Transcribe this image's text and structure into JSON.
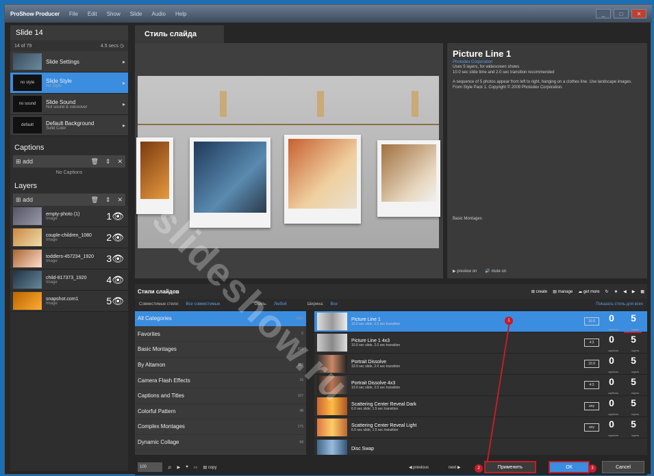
{
  "window": {
    "title": "ProShow Producer",
    "menu": [
      "File",
      "Edit",
      "Show",
      "Slide",
      "Audio",
      "Help"
    ]
  },
  "slide": {
    "title": "Slide 14",
    "index": "14 of 79",
    "time": "4.5 secs"
  },
  "slide_rows": [
    {
      "label": "Slide Settings",
      "sub": ""
    },
    {
      "label": "Slide Style",
      "sub": "No Style",
      "thumb": "no style"
    },
    {
      "label": "Slide Sound",
      "sub": "Not sound & voiceover",
      "thumb": "no sound"
    },
    {
      "label": "Default Background",
      "sub": "Solid Color",
      "thumb": "default"
    }
  ],
  "captions": {
    "title": "Captions",
    "add": "add",
    "empty": "No Captions"
  },
  "layers": {
    "title": "Layers",
    "add": "add",
    "items": [
      {
        "name": "empty-photo (1)",
        "type": "Image",
        "num": "1"
      },
      {
        "name": "couple-children_1080",
        "type": "Image",
        "num": "2"
      },
      {
        "name": "toddlers-457234_1920",
        "type": "Image",
        "num": "3"
      },
      {
        "name": "child-817373_1920",
        "type": "Image",
        "num": "4"
      },
      {
        "name": "snapshot.com1",
        "type": "Image",
        "num": "5"
      }
    ]
  },
  "tab": {
    "label": "Стиль слайда"
  },
  "style_info": {
    "title": "Picture Line 1",
    "link": "Photodex Corporation",
    "desc1": "Uses 5 layers, for widescreen shows",
    "desc2": "10.0 sec slide time and 2.0 sec transition recommended",
    "desc3": "A sequence of 5 photos appear from left to right, hanging on a clothes line. Use landscape images. From Style Pack 1. Copyright © 2009 Photodex Corporation.",
    "basic": "Basic Montages",
    "preview_btn": "preview on",
    "mute_btn": "mute on"
  },
  "watermark": "slideshow.ru",
  "styles_panel": {
    "title": "Стили слайдов",
    "tools": [
      "create",
      "manage",
      "get more"
    ],
    "filters": {
      "compat_label": "Совместимые стили:",
      "compat_val": "Все совместимые",
      "aspect_label": "Стиль:",
      "aspect_val": "Любой",
      "count_label": "Ширина:",
      "count_val": "Все",
      "recommend": "Показать стиль для всех"
    }
  },
  "categories": [
    {
      "name": "All Categories",
      "count": "1063",
      "sel": true
    },
    {
      "name": "Favorites",
      "count": "0"
    },
    {
      "name": "Basic Montages",
      "count": "216"
    },
    {
      "name": "By Altamon",
      "count": "368"
    },
    {
      "name": "Camera Flash Effects",
      "count": "16"
    },
    {
      "name": "Captions and Titles",
      "count": "107"
    },
    {
      "name": "Colorful Pattern",
      "count": "48"
    },
    {
      "name": "Complex Montages",
      "count": "175"
    },
    {
      "name": "Dynamic Collage",
      "count": "68"
    }
  ],
  "styles": [
    {
      "name": "Picture Line 1",
      "desc": "10.0 sec slide, 2.0 sec transition",
      "aspect": "16:9",
      "captions": "0",
      "layers": "5",
      "sel": true
    },
    {
      "name": "Picture Line 1 4x3",
      "desc": "10.0 sec slide, 2.0 sec transition",
      "aspect": "4:3",
      "captions": "0",
      "layers": "5"
    },
    {
      "name": "Portrait Dissolve",
      "desc": "10.0 sec slide, 2.0 sec transition",
      "aspect": "16:9",
      "captions": "0",
      "layers": "5"
    },
    {
      "name": "Portrait Dissolve 4x3",
      "desc": "10.0 sec slide, 2.0 sec transition",
      "aspect": "4:3",
      "captions": "0",
      "layers": "5"
    },
    {
      "name": "Scattering Center Reveal Dark",
      "desc": "6.0 sec slide, 1.5 sec transition",
      "aspect": "any",
      "captions": "0",
      "layers": "5"
    },
    {
      "name": "Scattering Center Reveal Light",
      "desc": "6.0 sec slide, 1.5 sec transition",
      "aspect": "any",
      "captions": "0",
      "layers": "5"
    },
    {
      "name": "Disc Swap",
      "desc": "",
      "aspect": "any",
      "captions": "0",
      "layers": "5"
    }
  ],
  "labels": {
    "captions": "captions",
    "layers": "layers",
    "aspect": "aspect"
  },
  "bottom": {
    "zoom": "100",
    "previous": "previous",
    "next": "next",
    "apply": "Применить",
    "ok": "ОК",
    "cancel": "Cancel",
    "copy": "copy"
  },
  "badges": {
    "b1": "1",
    "b2": "2",
    "b3": "3"
  }
}
